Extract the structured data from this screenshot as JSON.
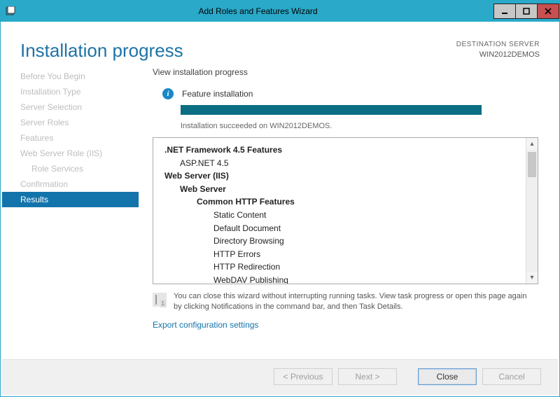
{
  "window": {
    "title": "Add Roles and Features Wizard"
  },
  "header": {
    "page_title": "Installation progress",
    "dest_label": "DESTINATION SERVER",
    "dest_name": "WIN2012DEMOS"
  },
  "sidebar": {
    "items": [
      {
        "label": "Before You Begin",
        "active": false,
        "indent": false
      },
      {
        "label": "Installation Type",
        "active": false,
        "indent": false
      },
      {
        "label": "Server Selection",
        "active": false,
        "indent": false
      },
      {
        "label": "Server Roles",
        "active": false,
        "indent": false
      },
      {
        "label": "Features",
        "active": false,
        "indent": false
      },
      {
        "label": "Web Server Role (IIS)",
        "active": false,
        "indent": false
      },
      {
        "label": "Role Services",
        "active": false,
        "indent": true
      },
      {
        "label": "Confirmation",
        "active": false,
        "indent": false
      },
      {
        "label": "Results",
        "active": true,
        "indent": false
      }
    ]
  },
  "main": {
    "view_label": "View installation progress",
    "status_title": "Feature installation",
    "succeeded": "Installation succeeded on WIN2012DEMOS.",
    "tree": {
      "l0a": ".NET Framework 4.5 Features",
      "l1a": "ASP.NET 4.5",
      "l0b": "Web Server (IIS)",
      "l1b": "Web Server",
      "l2b": "Common HTTP Features",
      "l3a": "Static Content",
      "l3b": "Default Document",
      "l3c": "Directory Browsing",
      "l3d": "HTTP Errors",
      "l3e": "HTTP Redirection",
      "l3f": "WebDAV Publishing"
    },
    "hint": "You can close this wizard without interrupting running tasks. View task progress or open this page again by clicking Notifications in the command bar, and then Task Details.",
    "export_link": "Export configuration settings"
  },
  "footer": {
    "previous": "< Previous",
    "next": "Next >",
    "close": "Close",
    "cancel": "Cancel"
  }
}
